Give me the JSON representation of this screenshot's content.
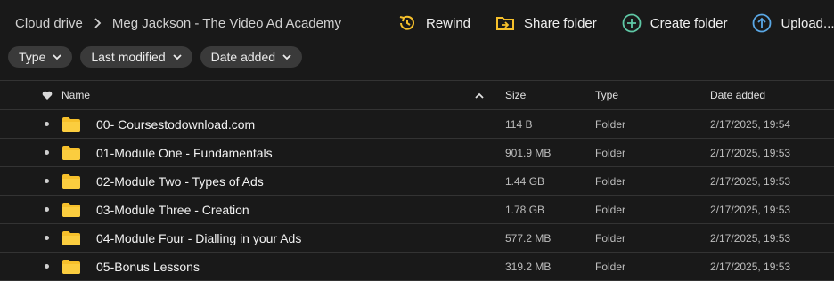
{
  "breadcrumb": {
    "root": "Cloud drive",
    "current": "Meg Jackson - The Video Ad Academy"
  },
  "actions": {
    "rewind": "Rewind",
    "share_folder": "Share folder",
    "create_folder": "Create folder",
    "upload": "Upload..."
  },
  "filters": {
    "type": "Type",
    "last_modified": "Last modified",
    "date_added": "Date added"
  },
  "columns": {
    "name": "Name",
    "size": "Size",
    "type": "Type",
    "date_added": "Date added"
  },
  "rows": [
    {
      "name": "00- Coursestodownload.com",
      "size": "114 B",
      "type": "Folder",
      "date": "2/17/2025, 19:54"
    },
    {
      "name": "01-Module One - Fundamentals",
      "size": "901.9 MB",
      "type": "Folder",
      "date": "2/17/2025, 19:53"
    },
    {
      "name": "02-Module Two - Types of Ads",
      "size": "1.44 GB",
      "type": "Folder",
      "date": "2/17/2025, 19:53"
    },
    {
      "name": "03-Module Three - Creation",
      "size": "1.78 GB",
      "type": "Folder",
      "date": "2/17/2025, 19:53"
    },
    {
      "name": "04-Module Four - Dialling in your Ads",
      "size": "577.2 MB",
      "type": "Folder",
      "date": "2/17/2025, 19:53"
    },
    {
      "name": "05-Bonus Lessons",
      "size": "319.2 MB",
      "type": "Folder",
      "date": "2/17/2025, 19:53"
    }
  ],
  "colors": {
    "background": "#191919",
    "folder": "#f6c02b",
    "rewind_accent": "#f6c02b",
    "share_accent": "#f6c02b",
    "create_accent": "#5fc8a6",
    "upload_accent": "#5aa8e6"
  },
  "icons": {
    "breadcrumb_separator": "chevron-right-icon",
    "rewind": "rewind-clock-icon",
    "share_folder": "share-folder-icon",
    "create_folder": "plus-circle-icon",
    "upload": "upload-arrow-circle-icon",
    "favourite": "heart-icon",
    "sort": "chevron-up-icon",
    "row_folder": "folder-icon"
  }
}
